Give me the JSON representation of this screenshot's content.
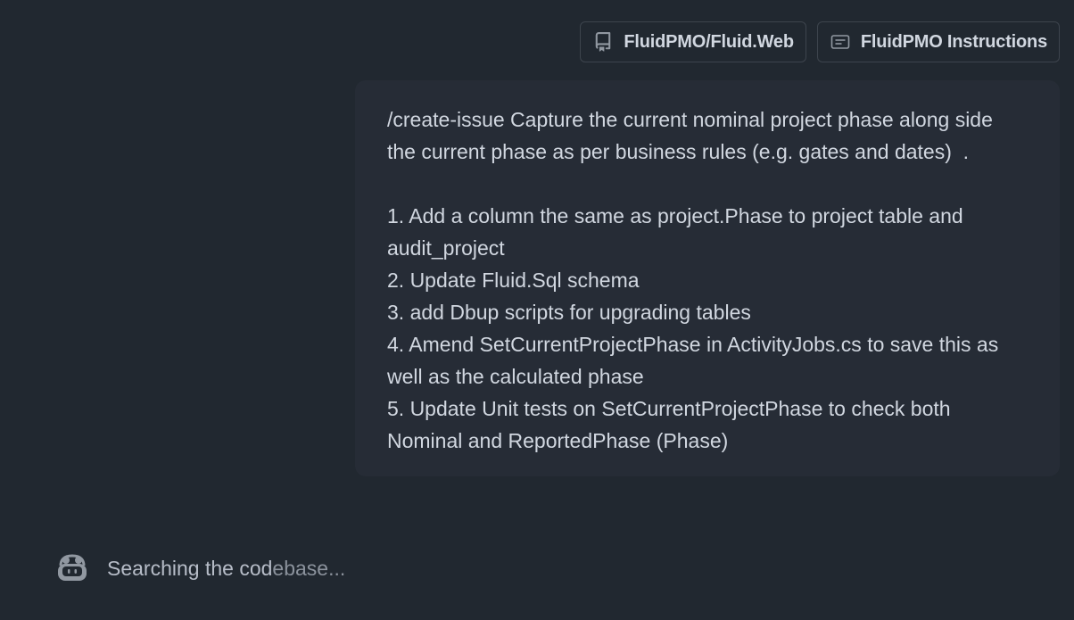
{
  "context_chips": [
    {
      "label": "FluidPMO/Fluid.Web",
      "icon": "repo-icon"
    },
    {
      "label": "FluidPMO Instructions",
      "icon": "instructions-icon"
    }
  ],
  "message": {
    "lines": [
      "/create-issue Capture the current nominal project phase along side",
      "the current phase as per business rules (e.g. gates and dates)  .",
      "",
      "1. Add a column the same as project.Phase to project table and",
      "audit_project",
      "2. Update Fluid.Sql schema",
      "3. add Dbup scripts for upgrading tables",
      "4. Amend SetCurrentProjectPhase in ActivityJobs.cs to save this as",
      "well as the calculated phase",
      "5. Update Unit tests on SetCurrentProjectPhase to check both",
      "Nominal and ReportedPhase (Phase)"
    ]
  },
  "status": {
    "icon": "copilot-icon",
    "text_main": "Searching the cod",
    "text_dim": "ebase..."
  }
}
